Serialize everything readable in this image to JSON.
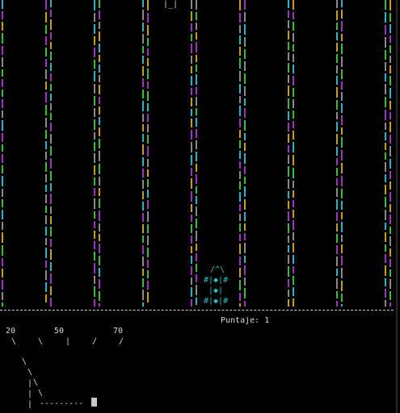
{
  "score": {
    "label": "Puntaje:",
    "value": "1"
  },
  "gauge": {
    "labels": [
      "20",
      "50",
      "70"
    ],
    "marks": [
      "\\",
      "\\",
      "|",
      "/",
      "/"
    ],
    "needle_line": "---------"
  },
  "enemy_glyph": "|_|",
  "player": {
    "top": "/^\\",
    "row1": "#|◆|#",
    "row2": "|◆|",
    "row3": "#|◆|#"
  },
  "colors": {
    "background": "#000000",
    "lane_yellow": "#c8a000",
    "lane_green": "#30c030",
    "lane_cyan": "#20b8c8",
    "lane_magenta": "#a030c0",
    "lane_gray": "#8a8a8a",
    "player": "#20c0c0"
  }
}
